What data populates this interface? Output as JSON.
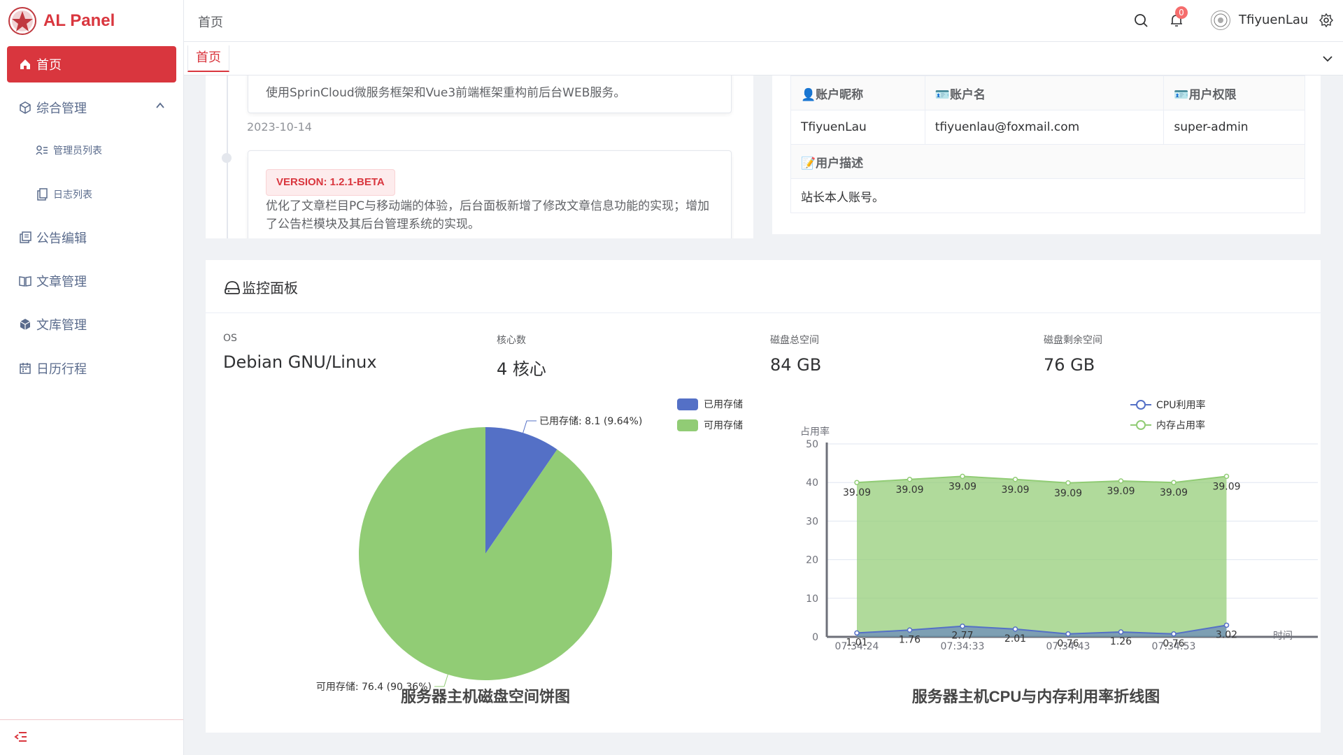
{
  "app": {
    "name": "AL Panel",
    "brand_color": "#d9363e"
  },
  "sidebar": {
    "items": [
      {
        "label": "首页",
        "icon": "home-icon",
        "active": true
      },
      {
        "label": "综合管理",
        "icon": "cube-icon",
        "expanded": true
      },
      {
        "label": "管理员列表",
        "icon": "users-list-icon",
        "sub": true
      },
      {
        "label": "日志列表",
        "icon": "clipboard-icon",
        "sub": true
      },
      {
        "label": "公告编辑",
        "icon": "notice-icon"
      },
      {
        "label": "文章管理",
        "icon": "book-icon"
      },
      {
        "label": "文库管理",
        "icon": "library-icon"
      },
      {
        "label": "日历行程",
        "icon": "calendar-icon"
      }
    ]
  },
  "topbar": {
    "breadcrumb": "首页",
    "notification_count": "0",
    "username": "TfiyuenLau"
  },
  "tags": {
    "active": "首页"
  },
  "timeline": {
    "item1_text": "使用SprinCloud微服务框架和Vue3前端框架重构前后台WEB服务。",
    "date": "2023-10-14",
    "item2_version": "VERSION: 1.2.1-BETA",
    "item2_text": "优化了文章栏目PC与移动端的体验，后台面板新增了修改文章信息功能的实现；增加了公告栏模块及其后台管理系统的实现。"
  },
  "account": {
    "nickname_label": "账户昵称",
    "account_label": "账户名",
    "role_label": "用户权限",
    "nickname": "TfiyuenLau",
    "account": "tfiyuenlau@foxmail.com",
    "role": "super-admin",
    "desc_label": "用户描述",
    "desc": "站长本人账号。"
  },
  "monitor": {
    "title": "监控面板",
    "stats": [
      {
        "label": "OS",
        "value": "Debian GNU/Linux"
      },
      {
        "label": "核心数",
        "value": "4 核心"
      },
      {
        "label": "磁盘总空间",
        "value": "84 GB"
      },
      {
        "label": "磁盘剩余空间",
        "value": "76 GB"
      }
    ]
  },
  "chart_data": [
    {
      "type": "pie",
      "title": "服务器主机磁盘空间饼图",
      "legend": [
        "已用存储",
        "可用存储"
      ],
      "legend_position": "top-right",
      "slices": [
        {
          "name": "已用存储",
          "value": 8.1,
          "label": "已用存储: 8.1 (9.64%)",
          "color": "#5470c6"
        },
        {
          "name": "可用存储",
          "value": 76.4,
          "label": "可用存储: 76.4 (90.36%)",
          "color": "#91cc75"
        }
      ]
    },
    {
      "type": "area",
      "title": "服务器主机CPU与内存利用率折线图",
      "ylabel": "占用率",
      "xlabel": "时间",
      "ylim": [
        0,
        50
      ],
      "yticks": [
        0,
        10,
        20,
        30,
        40,
        50
      ],
      "x_tick_labels": [
        "07:34:24",
        "07:34:33",
        "07:34:43",
        "07:34:53"
      ],
      "legend_position": "top-right",
      "series": [
        {
          "name": "CPU利用率",
          "color": "#5470c6",
          "values": [
            1.01,
            1.76,
            2.77,
            2.01,
            0.76,
            1.26,
            0.76,
            3.02
          ]
        },
        {
          "name": "内存占用率",
          "color": "#91cc75",
          "values": [
            39.09,
            39.09,
            39.09,
            39.09,
            39.09,
            39.09,
            39.09,
            39.09
          ],
          "plotted": [
            40.0,
            40.8,
            41.6,
            40.8,
            39.9,
            40.4,
            40.0,
            41.6
          ]
        }
      ]
    }
  ]
}
